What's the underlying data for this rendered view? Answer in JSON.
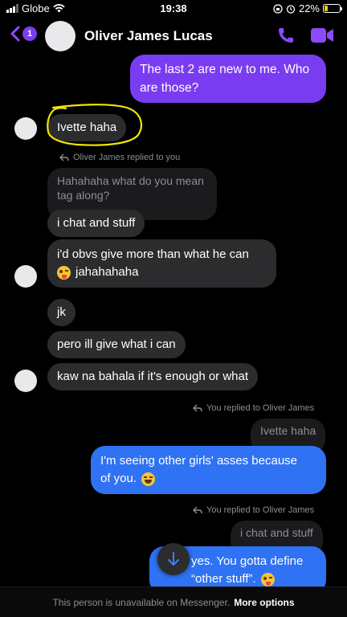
{
  "status_bar": {
    "carrier": "Globe",
    "time": "19:38",
    "battery": "22%",
    "battery_level": 0.22,
    "icons": [
      "signal-icon",
      "wifi-icon",
      "lock-rotation-icon",
      "alarm-icon",
      "battery-icon"
    ]
  },
  "header": {
    "back_badge": "1",
    "contact_name": "Oliver James Lucas",
    "accent": "#8c4bff",
    "icons": [
      "back-icon",
      "phone-icon",
      "video-icon"
    ]
  },
  "messages": {
    "m1": "The last 2 are new to me. Who are those?",
    "m2": "Ivette haha",
    "reply_note_1": "Oliver James replied to you",
    "quote_1": "Hahahaha what do you mean tag along?",
    "m3": "i chat and stuff",
    "m4_line1": "i'd obvs give more than what he can",
    "m4_line2": "jahahahaha",
    "m5": "jk",
    "m6": "pero ill give what i can",
    "m7": "kaw na bahala if it's enough or what",
    "reply_note_2": "You replied to Oliver James",
    "quote_2": "Ivette haha",
    "m8_line1": "I'm seeing other girls' asses because",
    "m8_line2": "of you.",
    "reply_note_3": "You replied to Oliver James",
    "quote_3": "i chat and stuff",
    "m9_line1": "yes. You gotta define",
    "m9_line2": "“other stuff”."
  },
  "footer": {
    "notice": "This person is unavailable on Messenger.",
    "action": "More options"
  },
  "colors": {
    "outgoing_purple": "#7a3cf0",
    "outgoing_blue": "#2f72f3",
    "incoming": "#2c2c2e",
    "highlight": "#f2e600"
  }
}
